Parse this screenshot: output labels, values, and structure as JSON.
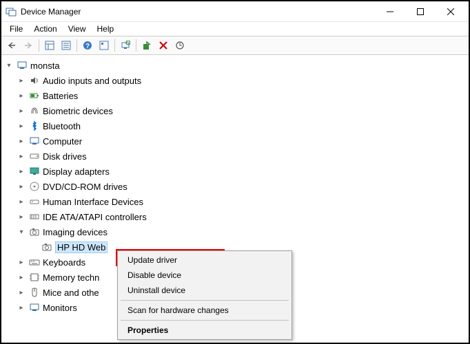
{
  "window": {
    "title": "Device Manager"
  },
  "menubar": [
    "File",
    "Action",
    "View",
    "Help"
  ],
  "toolbar_icons": [
    "back-arrow-icon",
    "forward-arrow-icon",
    "sep",
    "show-hidden-icon",
    "properties-icon",
    "sep",
    "help-icon",
    "action-icon",
    "sep",
    "scan-hardware-icon",
    "sep",
    "enable-device-icon",
    "uninstall-icon",
    "update-driver-icon"
  ],
  "tree": {
    "root": {
      "label": "monsta",
      "expanded": true
    },
    "categories": [
      {
        "icon": "audio-icon",
        "label": "Audio inputs and outputs",
        "expanded": false
      },
      {
        "icon": "battery-icon",
        "label": "Batteries",
        "expanded": false
      },
      {
        "icon": "fingerprint-icon",
        "label": "Biometric devices",
        "expanded": false
      },
      {
        "icon": "bluetooth-icon",
        "label": "Bluetooth",
        "expanded": false
      },
      {
        "icon": "computer-icon",
        "label": "Computer",
        "expanded": false
      },
      {
        "icon": "disk-icon",
        "label": "Disk drives",
        "expanded": false
      },
      {
        "icon": "display-icon",
        "label": "Display adapters",
        "expanded": false
      },
      {
        "icon": "dvd-icon",
        "label": "DVD/CD-ROM drives",
        "expanded": false
      },
      {
        "icon": "hid-icon",
        "label": "Human Interface Devices",
        "expanded": false
      },
      {
        "icon": "ide-icon",
        "label": "IDE ATA/ATAPI controllers",
        "expanded": false
      },
      {
        "icon": "camera-icon",
        "label": "Imaging devices",
        "expanded": true
      },
      {
        "icon": "keyboard-icon",
        "label": "Keyboards",
        "expanded": false
      },
      {
        "icon": "memory-icon",
        "label": "Memory techn",
        "expanded": false
      },
      {
        "icon": "mouse-icon",
        "label": "Mice and othe",
        "expanded": false
      },
      {
        "icon": "monitor-icon",
        "label": "Monitors",
        "expanded": false
      }
    ],
    "imaging_child": {
      "icon": "webcam-icon",
      "label": "HP HD Web"
    }
  },
  "context_menu": {
    "update": "Update driver",
    "disable": "Disable device",
    "uninstall": "Uninstall device",
    "scan": "Scan for hardware changes",
    "properties": "Properties"
  }
}
